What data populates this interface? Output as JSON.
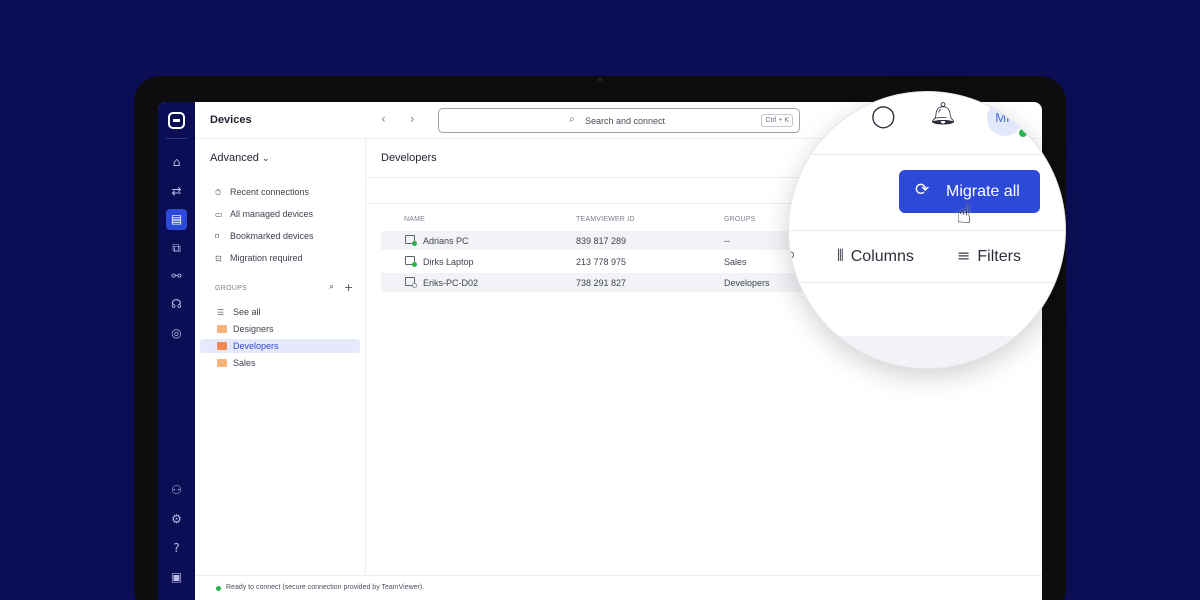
{
  "app": {
    "title": "Devices"
  },
  "search": {
    "placeholder": "Search and connect",
    "shortcut": "Ctrl + K"
  },
  "nav": {
    "mode_label": "Advanced",
    "items": [
      {
        "label": "Recent connections",
        "icon": "clock-icon"
      },
      {
        "label": "All managed devices",
        "icon": "devices-icon"
      },
      {
        "label": "Bookmarked devices",
        "icon": "bookmark-icon"
      },
      {
        "label": "Migration required",
        "icon": "migration-icon"
      }
    ],
    "groups_heading": "GROUPS",
    "groups": [
      {
        "label": "See all"
      },
      {
        "label": "Designers"
      },
      {
        "label": "Developers",
        "selected": true
      },
      {
        "label": "Sales"
      }
    ]
  },
  "main": {
    "title": "Developers",
    "columns": [
      "NAME",
      "TEAMVIEWER ID",
      "GROUPS"
    ],
    "rows": [
      {
        "name": "Adrians PC",
        "id": "839 817 289",
        "group": "--",
        "online": true
      },
      {
        "name": "Dirks Laptop",
        "id": "213 778 975",
        "group": "Sales",
        "online": true
      },
      {
        "name": "Eriks-PC-D02",
        "id": "738 291 827",
        "group": "Developers",
        "online": false
      }
    ]
  },
  "status": {
    "text": "Ready to connect (secure connection provided by TeamViewer)."
  },
  "magnifier": {
    "migrate_label": "Migrate all",
    "columns_label": "Columns",
    "filters_label": "Filters",
    "avatar_initials": "MK"
  },
  "colors": {
    "background": "#0c0e55",
    "accent": "#2d49d8",
    "online": "#27b34a",
    "folder": "#f5b47c"
  }
}
